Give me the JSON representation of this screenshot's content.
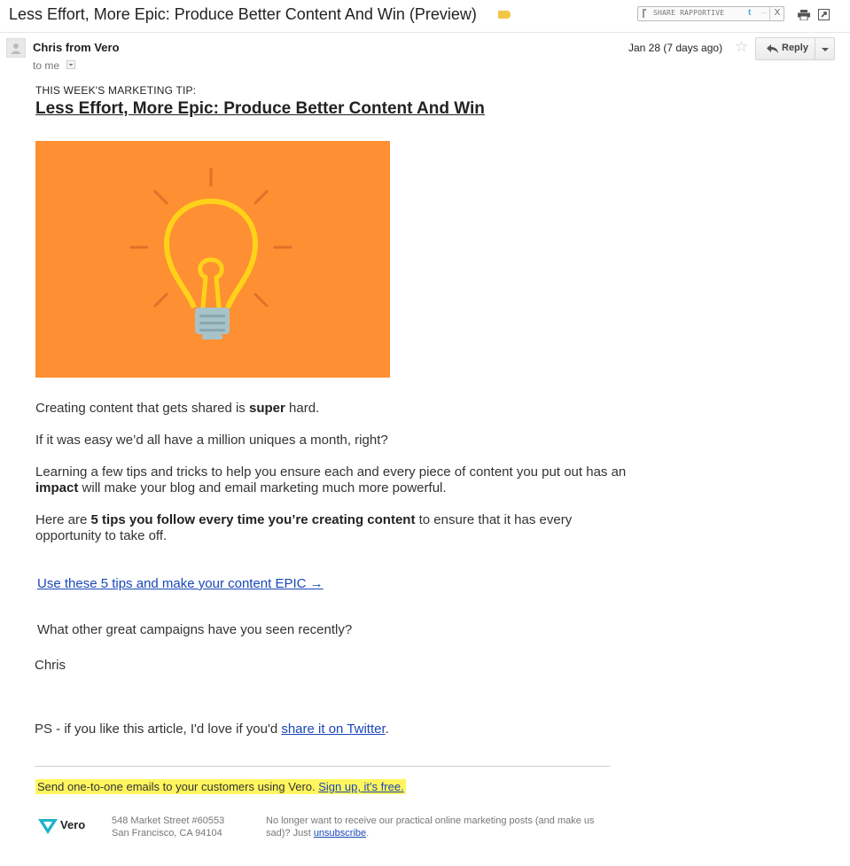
{
  "subject": {
    "title": "Less Effort, More Epic: Produce Better Content And Win (Preview)",
    "label_color": "#f2c744"
  },
  "rapportive": {
    "label": "SHARE RAPPORTIVE",
    "twitter": "t",
    "more": "...",
    "close": "X"
  },
  "toolbar": {
    "print_icon": "print-icon",
    "popout_icon": "popout-icon"
  },
  "message": {
    "sender": "Chris from Vero",
    "to": "to me",
    "date": "Jan 28 (7 days ago)",
    "star": "☆",
    "reply_label": "Reply"
  },
  "email": {
    "kicker": "THIS WEEK'S MARKETING TIP:",
    "headline": "Less Effort, More Epic: Produce Better Content And Win",
    "hero_color": "#fe8f32",
    "p1": {
      "a": "Creating content that gets shared is ",
      "b": "super",
      "c": " hard."
    },
    "p2": "If it was easy we’d all have a million uniques a month, right?",
    "p3": {
      "a": "Learning a few tips and tricks to help you ensure each and every piece of content you put out has an ",
      "b": "impact",
      "c": " will make your blog and email marketing much more powerful."
    },
    "p4": {
      "a": "Here are ",
      "b": "5 tips you follow every time you’re creating content",
      "c": " to ensure that it has every opportunity to take off."
    },
    "cta": "Use these 5 tips and make your content EPIC →",
    "question": "What other great campaigns have you seen recently?",
    "signoff": "Chris",
    "ps": {
      "a": "PS - if you like this article, I'd love if you'd ",
      "link": "share it on Twitter",
      "c": "."
    }
  },
  "footer": {
    "promo_text": "Send one-to-one emails to your customers using Vero. ",
    "promo_link": "Sign up, it's free.",
    "brand": "Vero",
    "address_line1": "548 Market Street #60553",
    "address_line2": "San Francisco, CA 94104",
    "unsub_text": "No longer want to receive our practical online marketing posts (and make us sad)? Just ",
    "unsub_link": "unsubscribe",
    "unsub_end": ".",
    "highlight_color": "#fff65f"
  }
}
